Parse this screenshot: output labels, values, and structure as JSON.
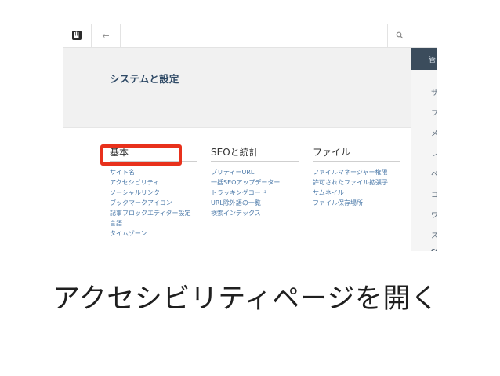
{
  "screen": {
    "page_title": "システムと設定",
    "columns": [
      {
        "heading": "基本",
        "links": [
          "サイト名",
          "アクセシビリティ",
          "ソーシャルリンク",
          "ブックマークアイコン",
          "記事ブロックエディター設定",
          "言語",
          "タイムゾーン"
        ]
      },
      {
        "heading": "SEOと統計",
        "links": [
          "プリティーURL",
          "一括SEOアップデーター",
          "トラッキングコード",
          "URL除外語の一覧",
          "検索インデックス"
        ]
      },
      {
        "heading": "ファイル",
        "links": [
          "ファイルマネージャー権限",
          "許可されたファイル拡張子",
          "サムネイル",
          "ファイル保存場所"
        ]
      }
    ],
    "right_panel": {
      "header": "管",
      "items": [
        "サ",
        "フ",
        "メ",
        "レ",
        "ペ",
        "コ",
        "ワ",
        "ス",
        "co"
      ]
    }
  },
  "caption": "アクセシビリティページを開く",
  "colors": {
    "highlight": "#e8311c",
    "link": "#4a78a8",
    "title": "#2f4a66"
  },
  "icons": {
    "logo": "concrete5-hand-icon",
    "back": "arrow-left-icon",
    "search": "search-icon"
  }
}
